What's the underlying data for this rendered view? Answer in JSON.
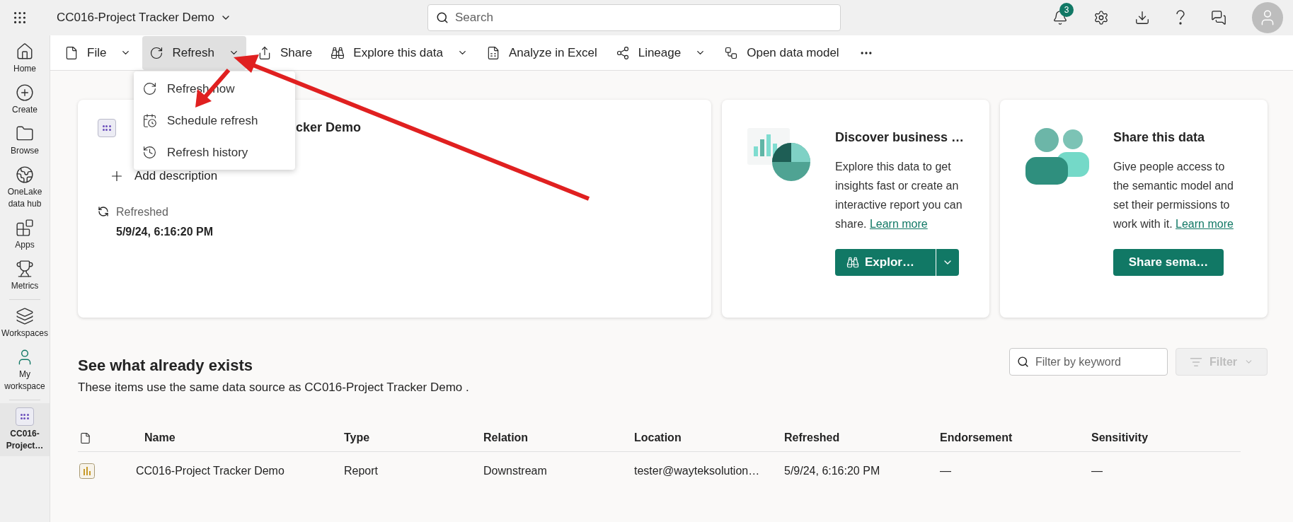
{
  "app_bar": {
    "title": "CC016-Project Tracker Demo",
    "search": {
      "placeholder": "Search"
    },
    "notification_count": "3"
  },
  "sidebar": {
    "items": [
      {
        "label": "Home",
        "kind": "nav",
        "selected": false
      },
      {
        "label": "Create",
        "kind": "nav",
        "selected": false
      },
      {
        "label": "Browse",
        "kind": "nav",
        "selected": false
      },
      {
        "label": "OneLake data hub",
        "kind": "nav",
        "selected": false
      },
      {
        "label": "Apps",
        "kind": "nav",
        "selected": false
      },
      {
        "label": "Metrics",
        "kind": "nav",
        "selected": false
      },
      {
        "label": "Workspaces",
        "kind": "nav",
        "selected": false
      },
      {
        "label": "My workspace",
        "kind": "workspace",
        "selected": false
      },
      {
        "label": "CC016-Project…",
        "kind": "item",
        "selected": true
      }
    ]
  },
  "toolbar": {
    "items": [
      {
        "label": "File",
        "dropdown": true,
        "expanded": false
      },
      {
        "label": "Refresh",
        "dropdown": true,
        "expanded": true
      },
      {
        "label": "Share",
        "dropdown": false,
        "expanded": false
      },
      {
        "label": "Explore this data",
        "dropdown": true,
        "expanded": false
      },
      {
        "label": "Analyze in Excel",
        "dropdown": false,
        "expanded": false
      },
      {
        "label": "Lineage",
        "dropdown": true,
        "expanded": false
      },
      {
        "label": "Open data model",
        "dropdown": false,
        "expanded": false
      }
    ]
  },
  "refresh_menu": {
    "items": [
      "Refresh now",
      "Schedule refresh",
      "Refresh history"
    ]
  },
  "model_card": {
    "title_fragment": "cker Demo",
    "add_description": "Add description",
    "refreshed_label": "Refreshed",
    "refreshed_value": "5/9/24, 6:16:20 PM"
  },
  "explore_card": {
    "heading": "Discover business …",
    "body": "Explore this data to get insights fast or create an interactive report you can share.",
    "link": "Learn more",
    "button": "Explor…"
  },
  "share_card": {
    "heading": "Share this data",
    "body": "Give people access to the semantic model and set their permissions to work with it.",
    "link": "Learn more",
    "button": "Share sema…"
  },
  "related": {
    "heading": "See what already exists",
    "subtitle": "These items use the same data source as CC016-Project Tracker Demo .",
    "filter_field": {
      "placeholder": "Filter by keyword"
    },
    "filter_button": {
      "label": "Filter",
      "disabled": true
    },
    "table": {
      "columns": [
        "Name",
        "Type",
        "Relation",
        "Location",
        "Refreshed",
        "Endorsement",
        "Sensitivity"
      ],
      "rows": [
        {
          "cells": [
            "CC016-Project Tracker Demo",
            "Report",
            "Downstream",
            "tester@wayteksolution…",
            "5/9/24, 6:16:20 PM",
            "—",
            "—"
          ]
        }
      ]
    }
  }
}
